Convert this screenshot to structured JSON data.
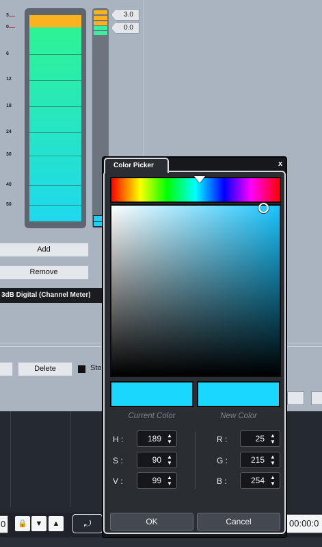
{
  "meter": {
    "scale": [
      "3",
      "0",
      "6",
      "12",
      "18",
      "24",
      "30",
      "40",
      "50"
    ],
    "max_value": "3.0",
    "current_value": "0.0"
  },
  "buttons": {
    "add": "Add",
    "remove": "Remove",
    "delete": "Delete"
  },
  "channel_label": "3dB Digital (Channel Meter)",
  "stop_label": "Sto",
  "transport": {
    "left_value": "0",
    "time": "00:00:0"
  },
  "color_picker": {
    "title": "Color Picker",
    "close": "x",
    "current_color_label": "Current Color",
    "new_color_label": "New Color",
    "current_color": "#1ad7fe",
    "new_color": "#19d7fe",
    "hue_position": 0.525,
    "fields": {
      "h": {
        "label": "H :",
        "value": "189"
      },
      "s": {
        "label": "S :",
        "value": "90"
      },
      "v": {
        "label": "V :",
        "value": "99"
      },
      "r": {
        "label": "R :",
        "value": "25"
      },
      "g": {
        "label": "G :",
        "value": "215"
      },
      "b": {
        "label": "B :",
        "value": "254"
      }
    },
    "ok": "OK",
    "cancel": "Cancel"
  },
  "colors": {
    "meter_clip": "#fbb21f",
    "meter_top": "#2ff58e",
    "meter_bottom": "#1fd8ee"
  }
}
